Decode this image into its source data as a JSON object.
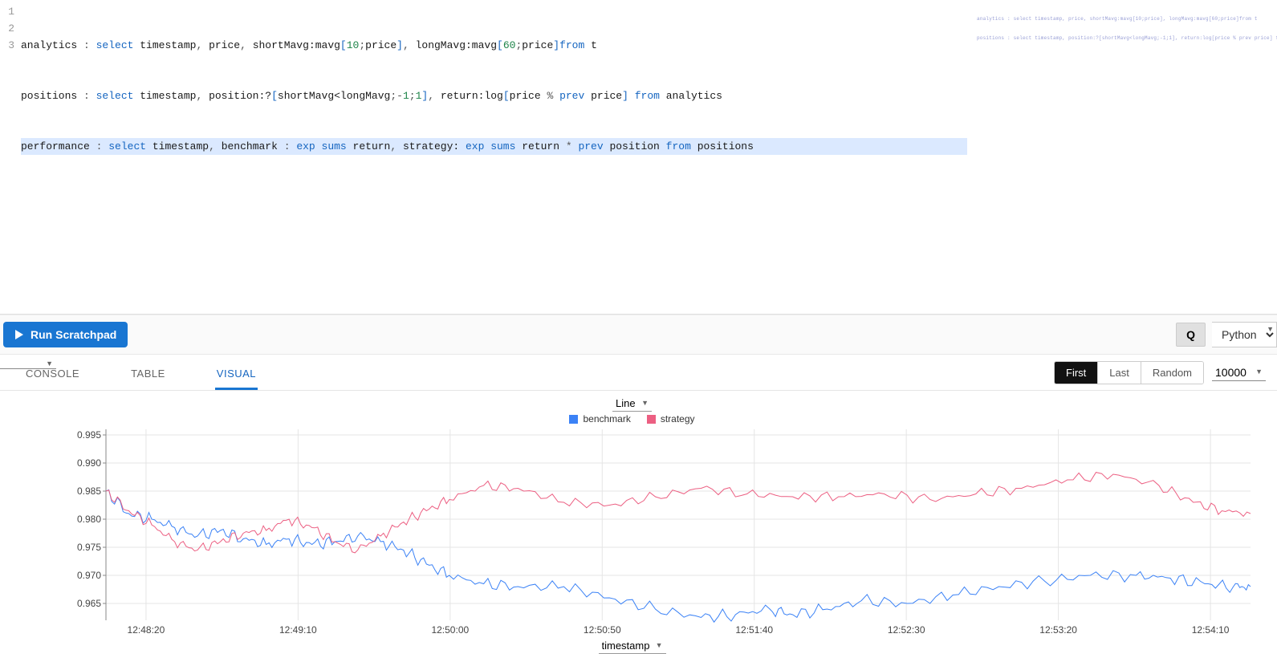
{
  "editor": {
    "line_numbers": [
      "1",
      "2",
      "3"
    ],
    "line1": {
      "var": "analytics",
      "assign": " : ",
      "kw1": "select",
      "sp": " ",
      "a": "timestamp",
      "c1": ", ",
      "b": "price",
      "c2": ", ",
      "c": "shortMavg:mavg",
      "br1": "[",
      "n1": "10",
      "semi1": ";",
      "d": "price",
      "br2": "]",
      "c3": ", ",
      "e": "longMavg:mavg",
      "br3": "[",
      "n2": "60",
      "semi2": ";",
      "f": "price",
      "br4": "]",
      "kw2": "from",
      "sp2": " ",
      "g": "t"
    },
    "line2": {
      "var": "positions",
      "assign": " : ",
      "kw1": "select",
      "sp": " ",
      "a": "timestamp",
      "c1": ", ",
      "b": "position:?",
      "br1": "[",
      "expr": "shortMavg<longMavg",
      "semi": ";",
      "neg": "-",
      "n1": "1",
      "semi2": ";",
      "n2": "1",
      "br2": "]",
      "c2": ", ",
      "c": "return:log",
      "br3": "[",
      "d": "price ",
      "pct": "%",
      "kw2": " prev ",
      "e": "price",
      "br4": "]",
      "kw3": " from ",
      "f": "analytics"
    },
    "line3": {
      "var": "performance",
      "assign": " : ",
      "kw1": "select",
      "sp": " ",
      "a": "timestamp",
      "c1": ", ",
      "b": "benchmark",
      "col": " : ",
      "kw2": "exp sums",
      "sp2": " ",
      "c": "return",
      "c2": ", ",
      "d": "strategy: ",
      "kw3": "exp sums",
      "sp3": " ",
      "e": "return ",
      "ast": "*",
      "kw4": " prev ",
      "f": "position",
      "kw5": " from ",
      "g": "positions"
    },
    "minimap_lines": [
      "analytics : select timestamp, price, shortMavg:mavg[10;price], longMavg:mavg[60;price]from t",
      "positions : select timestamp, position:?[shortMavg<longMavg;-1;1], return:log[price % prev price] from analytics"
    ]
  },
  "toolbar": {
    "run_label": "Run Scratchpad",
    "q_label": "Q",
    "lang_value": "Python"
  },
  "tabs": {
    "console": "CONSOLE",
    "table": "TABLE",
    "visual": "VISUAL"
  },
  "controls": {
    "first": "First",
    "last": "Last",
    "random": "Random",
    "count": "10000"
  },
  "chart_header": {
    "type_value": "Line",
    "legend_benchmark": "benchmark",
    "legend_strategy": "strategy",
    "benchmark_color": "#3b82f6",
    "strategy_color": "#ec5f82"
  },
  "x_title": "timestamp",
  "chart_data": {
    "type": "line",
    "title": "",
    "xlabel": "timestamp",
    "ylabel": "",
    "ylim": [
      0.962,
      0.996
    ],
    "y_ticks": [
      0.965,
      0.97,
      0.975,
      0.98,
      0.985,
      0.99,
      0.995
    ],
    "x_ticks": [
      "12:48:20",
      "12:49:10",
      "12:50:00",
      "12:50:50",
      "12:51:40",
      "12:52:30",
      "12:53:20",
      "12:54:10"
    ],
    "legend_position": "top",
    "grid": true,
    "series": [
      {
        "name": "benchmark",
        "color": "#3b82f6",
        "x": [
          0,
          0.02,
          0.04,
          0.06,
          0.08,
          0.1,
          0.12,
          0.14,
          0.16,
          0.18,
          0.2,
          0.22,
          0.24,
          0.26,
          0.28,
          0.3,
          0.33,
          0.36,
          0.4,
          0.44,
          0.48,
          0.52,
          0.55,
          0.58,
          0.6,
          0.63,
          0.66,
          0.7,
          0.74,
          0.78,
          0.82,
          0.86,
          0.9,
          0.93,
          0.96,
          0.985,
          1.0
        ],
        "values": [
          0.985,
          0.981,
          0.98,
          0.9785,
          0.977,
          0.978,
          0.9765,
          0.9755,
          0.9765,
          0.9755,
          0.976,
          0.977,
          0.976,
          0.9745,
          0.972,
          0.97,
          0.9685,
          0.968,
          0.968,
          0.966,
          0.964,
          0.9625,
          0.963,
          0.964,
          0.963,
          0.964,
          0.9655,
          0.965,
          0.9665,
          0.968,
          0.969,
          0.97,
          0.97,
          0.9695,
          0.9685,
          0.968,
          0.968
        ]
      },
      {
        "name": "strategy",
        "color": "#ec5f82",
        "x": [
          0,
          0.02,
          0.04,
          0.06,
          0.08,
          0.1,
          0.12,
          0.14,
          0.16,
          0.18,
          0.2,
          0.22,
          0.24,
          0.26,
          0.28,
          0.3,
          0.33,
          0.36,
          0.4,
          0.44,
          0.48,
          0.52,
          0.56,
          0.6,
          0.64,
          0.68,
          0.72,
          0.76,
          0.8,
          0.84,
          0.88,
          0.92,
          0.95,
          0.975,
          1.0
        ],
        "values": [
          0.985,
          0.9815,
          0.979,
          0.976,
          0.9745,
          0.976,
          0.9775,
          0.978,
          0.98,
          0.9785,
          0.976,
          0.9745,
          0.977,
          0.9795,
          0.9815,
          0.9835,
          0.986,
          0.9855,
          0.983,
          0.9825,
          0.984,
          0.9855,
          0.9845,
          0.984,
          0.984,
          0.9845,
          0.9835,
          0.9845,
          0.9855,
          0.987,
          0.988,
          0.986,
          0.983,
          0.9815,
          0.981
        ]
      }
    ]
  }
}
